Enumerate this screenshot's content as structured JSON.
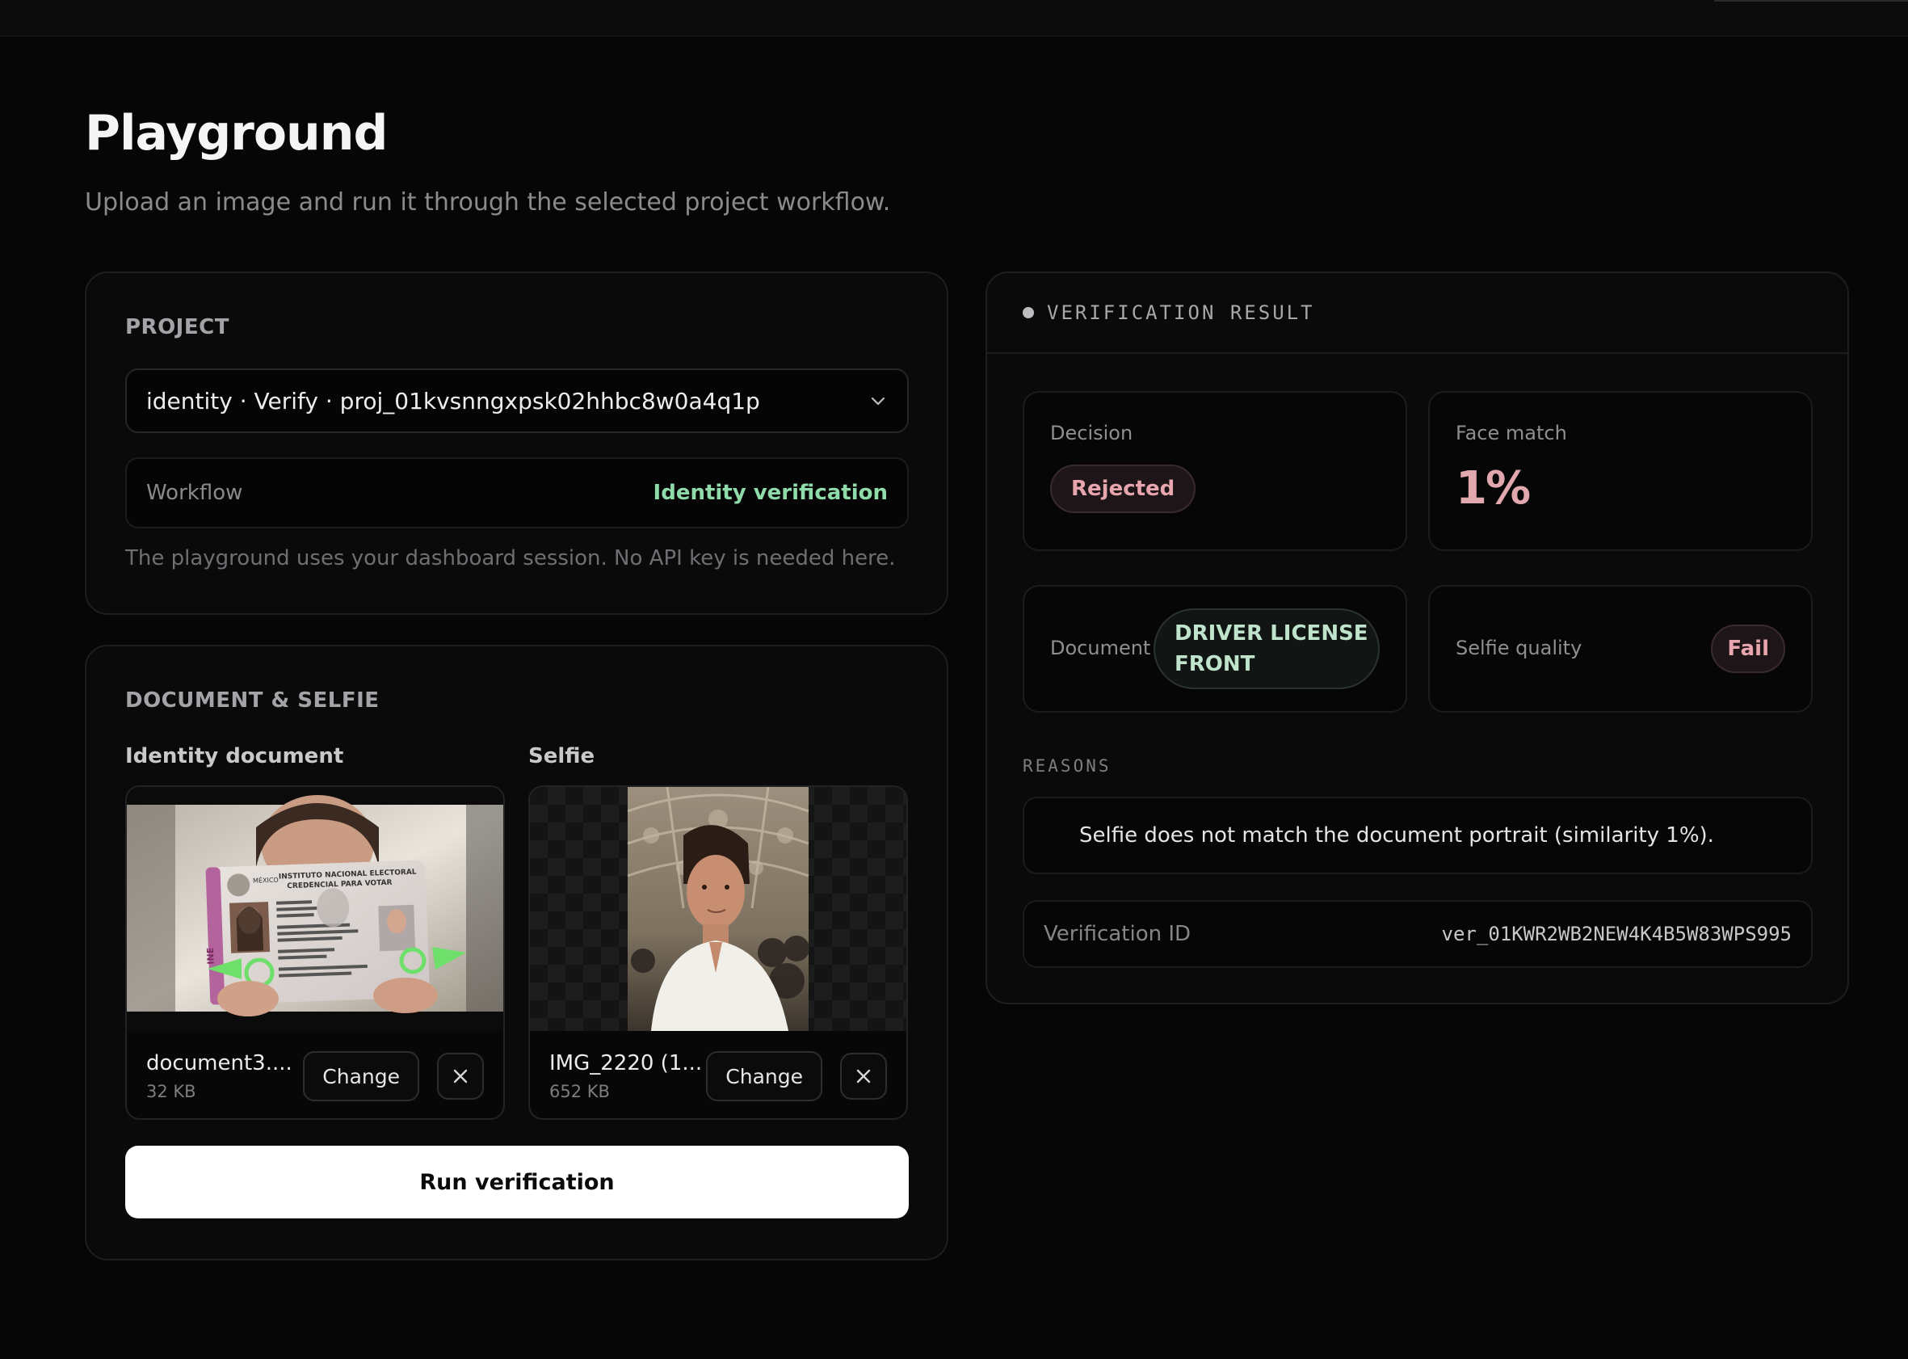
{
  "page": {
    "title": "Playground",
    "subtitle": "Upload an image and run it through the selected project workflow."
  },
  "project": {
    "section_title": "PROJECT",
    "selected": "identity · Verify · proj_01kvsnngxpsk02hhbc8w0a4q1p",
    "workflow_label": "Workflow",
    "workflow_value": "Identity verification",
    "note": "The playground uses your dashboard session. No API key is needed here."
  },
  "uploads": {
    "section_title": "DOCUMENT & SELFIE",
    "document": {
      "label": "Identity document",
      "file_name": "document3....",
      "file_size": "32 KB",
      "change_label": "Change",
      "card_lines": [
        "MÉXICO",
        "INSTITUTO NACIONAL ELECTORAL",
        "CREDENCIAL PARA VOTAR",
        "INE"
      ]
    },
    "selfie": {
      "label": "Selfie",
      "file_name": "IMG_2220 (1...",
      "file_size": "652 KB",
      "change_label": "Change"
    },
    "run_label": "Run verification"
  },
  "result": {
    "title": "VERIFICATION RESULT",
    "decision_label": "Decision",
    "decision_value": "Rejected",
    "face_match_label": "Face match",
    "face_match_value": "1%",
    "document_label": "Document",
    "document_value": "DRIVER LICENSE FRONT",
    "selfie_quality_label": "Selfie quality",
    "selfie_quality_value": "Fail",
    "reasons_label": "REASONS",
    "reasons": [
      "Selfie does not match the document portrait (similarity 1%)."
    ],
    "verification_id_label": "Verification ID",
    "verification_id": "ver_01KWR2WB2NEW4K4B5W83WPS995"
  },
  "colors": {
    "background": "#060606",
    "success": "#8fdcaa",
    "danger": "#e7a6ad",
    "primary_button": "#ffffff"
  }
}
